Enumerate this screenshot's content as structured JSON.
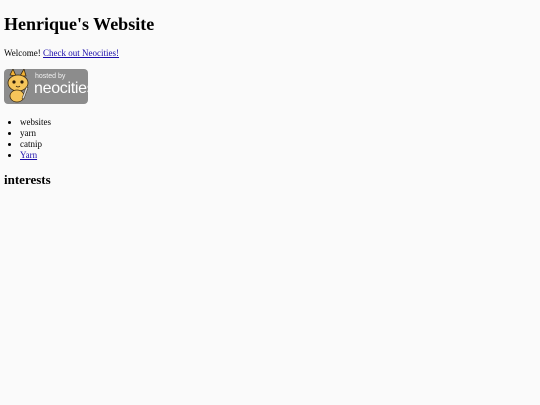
{
  "page": {
    "title": "Henrique's Website",
    "welcome_text": "Welcome! ",
    "welcome_link": "Check out Neocities!",
    "badge": {
      "small_text": "hosted by",
      "big_text": "neocities"
    },
    "list_items": [
      "websites",
      "yarn",
      "catnip"
    ],
    "list_link": "Yarn",
    "section_heading": "interests"
  }
}
